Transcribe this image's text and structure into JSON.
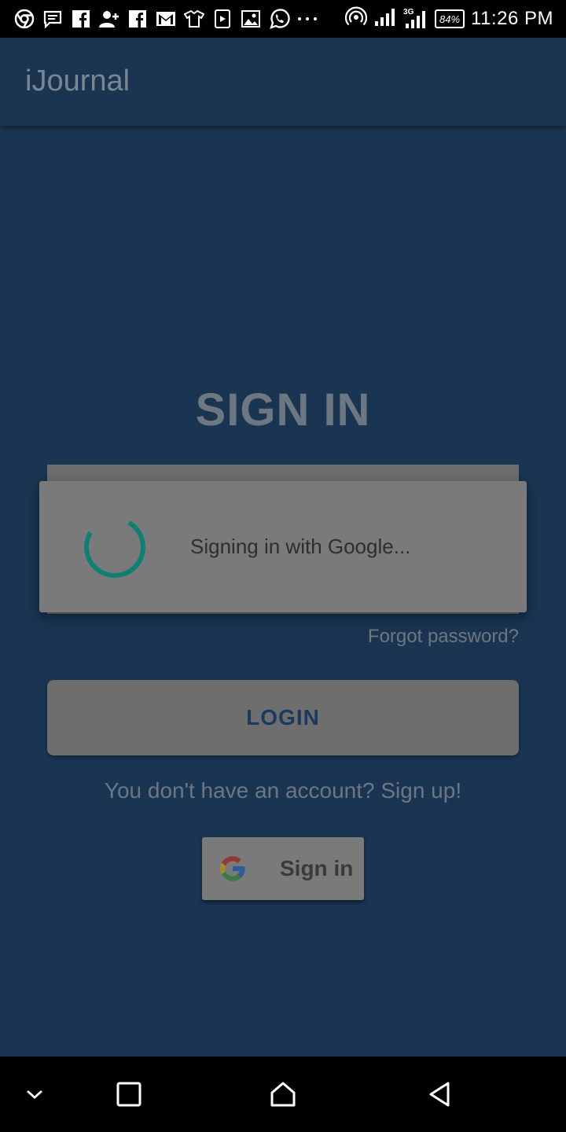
{
  "status_bar": {
    "icons": [
      "chrome-icon",
      "message-icon",
      "facebook-icon",
      "add-contact-icon",
      "facebook-icon",
      "gmail-icon",
      "shirt-icon",
      "play-store-icon",
      "image-icon",
      "whatsapp-icon",
      "more-dots-icon"
    ],
    "network_label": "3G",
    "battery": "84%",
    "time": "11:26 PM"
  },
  "app_bar": {
    "title": "iJournal"
  },
  "page": {
    "heading": "SIGN IN"
  },
  "dialog": {
    "message": "Signing in with Google...",
    "spinner_color": "#0e7f73"
  },
  "links": {
    "forgot_password": "Forgot password?",
    "signup": "You don't have an account? Sign up!"
  },
  "buttons": {
    "login": "LOGIN",
    "google_sign_in": "Sign in"
  },
  "nav_bar": {
    "icons": [
      "chevron-down-icon",
      "recents-icon",
      "home-icon",
      "back-icon"
    ]
  },
  "colors": {
    "background": "#1a3552",
    "scrim_text": "#6d7782",
    "login_text": "#1c3a5e"
  }
}
